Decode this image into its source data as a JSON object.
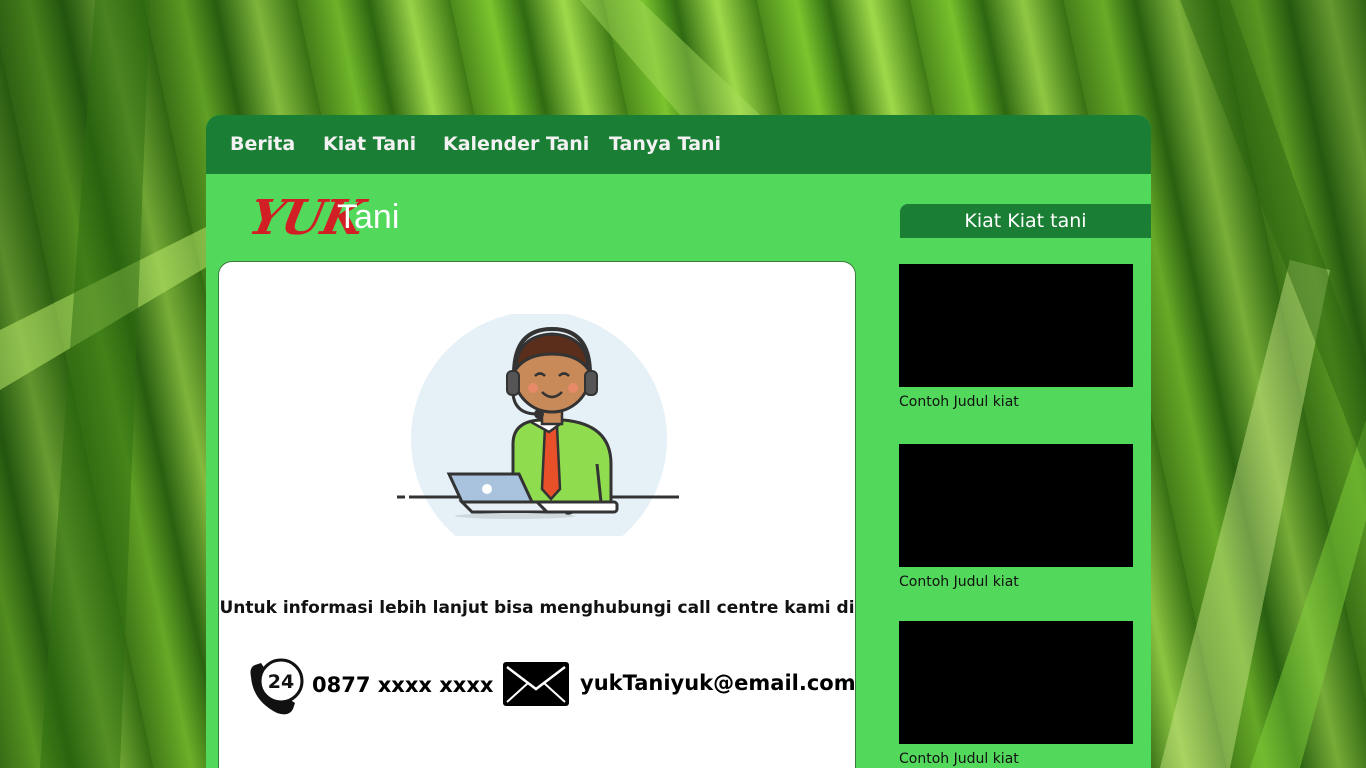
{
  "nav": {
    "items": [
      {
        "label": "Berita"
      },
      {
        "label": "Kiat Tani"
      },
      {
        "label": "Kalender Tani"
      },
      {
        "label": "Tanya Tani"
      }
    ]
  },
  "logo": {
    "part1": "YUK",
    "part2": "Tani"
  },
  "contact": {
    "info_text": "Untuk informasi lebih lanjut bisa menghubungi call centre kami di",
    "phone_icon_label": "24",
    "phone": "0877 xxxx xxxx",
    "email": "yukTaniyuk@email.com"
  },
  "sidebar": {
    "title": "Kiat Kiat tani",
    "items": [
      {
        "caption": "Contoh Judul kiat"
      },
      {
        "caption": "Contoh Judul kiat"
      },
      {
        "caption": "Contoh Judul kiat"
      }
    ]
  },
  "colors": {
    "nav_bg": "#1a7e35",
    "panel_bg": "#52d85a",
    "logo_red": "#d21f26"
  },
  "icons": [
    "phone-24-icon",
    "mail-icon",
    "support-agent-illustration"
  ]
}
